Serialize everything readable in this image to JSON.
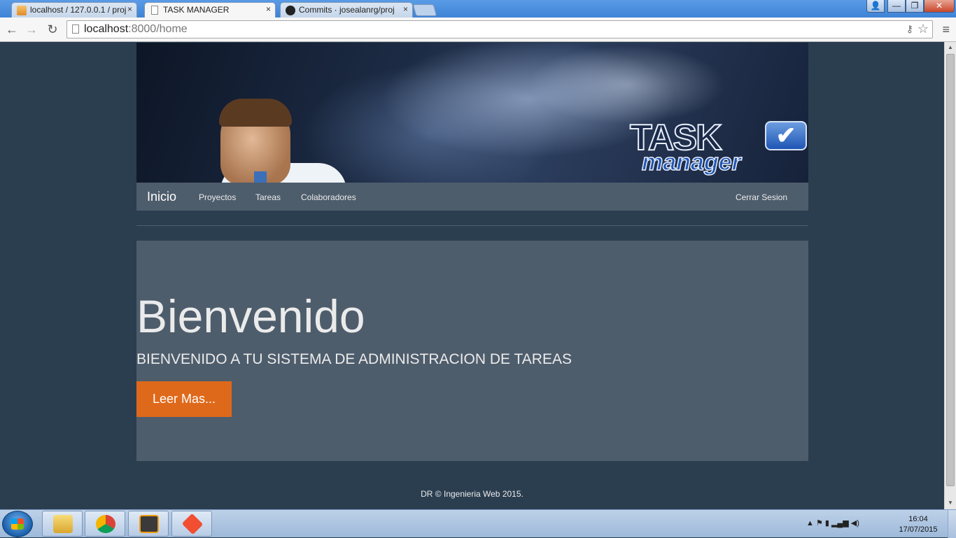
{
  "browser": {
    "tabs": [
      {
        "title": "localhost / 127.0.0.1 / proj",
        "icon": "phpmyadmin-icon",
        "active": false
      },
      {
        "title": "TASK MANAGER",
        "icon": "page-icon",
        "active": true
      },
      {
        "title": "Commits · josealanrg/proj",
        "icon": "github-icon",
        "active": false
      }
    ],
    "close_glyph": "×",
    "url_host": "localhost",
    "url_path": ":8000/home",
    "window_controls": {
      "user": "👤",
      "minimize": "—",
      "restore": "❐",
      "close": "✕"
    },
    "nav": {
      "back": "←",
      "forward": "→",
      "reload": "↻",
      "menu": "≡",
      "star": "☆",
      "key": "⚷"
    }
  },
  "banner": {
    "logo_word_1": "TASK",
    "logo_word_2": "manager",
    "logo_check": "✔"
  },
  "navbar": {
    "brand": "Inicio",
    "links": [
      "Proyectos",
      "Tareas",
      "Colaboradores"
    ],
    "right_link": "Cerrar Sesion"
  },
  "jumbotron": {
    "heading": "Bienvenido",
    "lead": "BIENVENIDO A TU SISTEMA DE ADMINISTRACION DE TAREAS",
    "button": "Leer Mas..."
  },
  "footer": {
    "text": "DR © Ingenieria Web 2015."
  },
  "taskbar": {
    "apps": [
      "file-explorer-icon",
      "chrome-icon",
      "sublime-text-icon",
      "git-icon"
    ],
    "tray_glyphs": "▲ ⚑ ▮ ▂▄▆ ◀)",
    "time": "16:04",
    "date": "17/07/2015"
  },
  "colors": {
    "page_background": "#2b3e50",
    "panel": "#4e5d6c",
    "accent_button": "#df691a",
    "text_light": "#ebebeb"
  }
}
